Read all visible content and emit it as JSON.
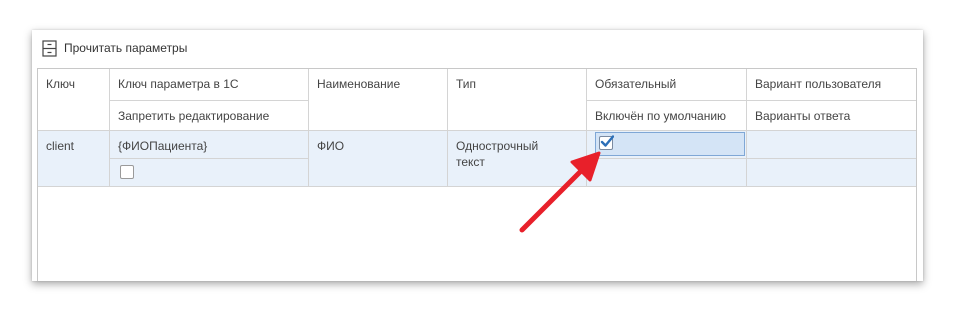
{
  "toolbar": {
    "read_params_label": "Прочитать параметры",
    "read_params_icon": "read-parameters-icon"
  },
  "table": {
    "headers_row1": {
      "key": "Ключ",
      "param_key_1c": "Ключ параметра в 1С",
      "name": "Наименование",
      "type": "Тип",
      "required": "Обязательный",
      "user_variant": "Вариант пользователя"
    },
    "headers_row2": {
      "forbid_edit": "Запретить редактирование",
      "enabled_default": "Включён по умолчанию",
      "answer_variants": "Варианты ответа"
    },
    "rows": [
      {
        "key": "client",
        "param_key_1c": "{ФИОПациента}",
        "forbid_edit": false,
        "name": "ФИО",
        "type_line1": "Однострочный",
        "type_line2": "текст",
        "required": true,
        "user_variant": ""
      }
    ]
  },
  "colors": {
    "selected_row": "#e9f1fa",
    "edit_cell": "#d4e4f6",
    "check_color": "#2c6fb8",
    "arrow_color": "#e8202a"
  }
}
